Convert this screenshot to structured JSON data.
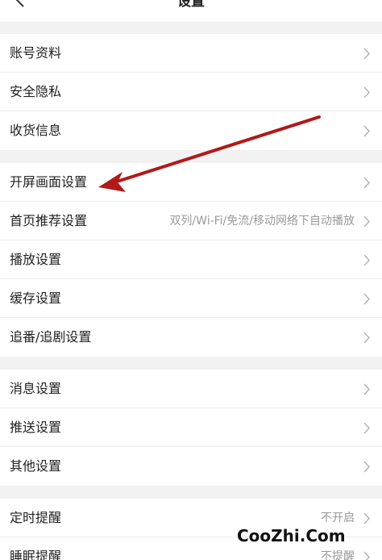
{
  "header": {
    "title": "设置"
  },
  "groups": [
    {
      "items": [
        {
          "label": "账号资料",
          "value": ""
        },
        {
          "label": "安全隐私",
          "value": ""
        },
        {
          "label": "收货信息",
          "value": ""
        }
      ]
    },
    {
      "items": [
        {
          "label": "开屏画面设置",
          "value": ""
        },
        {
          "label": "首页推荐设置",
          "value": "双列/Wi-Fi/免流/移动网络下自动播放"
        },
        {
          "label": "播放设置",
          "value": ""
        },
        {
          "label": "缓存设置",
          "value": ""
        },
        {
          "label": "追番/追剧设置",
          "value": ""
        }
      ]
    },
    {
      "items": [
        {
          "label": "消息设置",
          "value": ""
        },
        {
          "label": "推送设置",
          "value": ""
        },
        {
          "label": "其他设置",
          "value": ""
        }
      ]
    },
    {
      "items": [
        {
          "label": "定时提醒",
          "value": "不开启"
        },
        {
          "label": "睡眠提醒",
          "value": "不提醒"
        }
      ]
    }
  ],
  "annotation": {
    "color": "#b01a1a",
    "icon": "arrow-icon"
  },
  "watermark": "CooZhi.Com"
}
